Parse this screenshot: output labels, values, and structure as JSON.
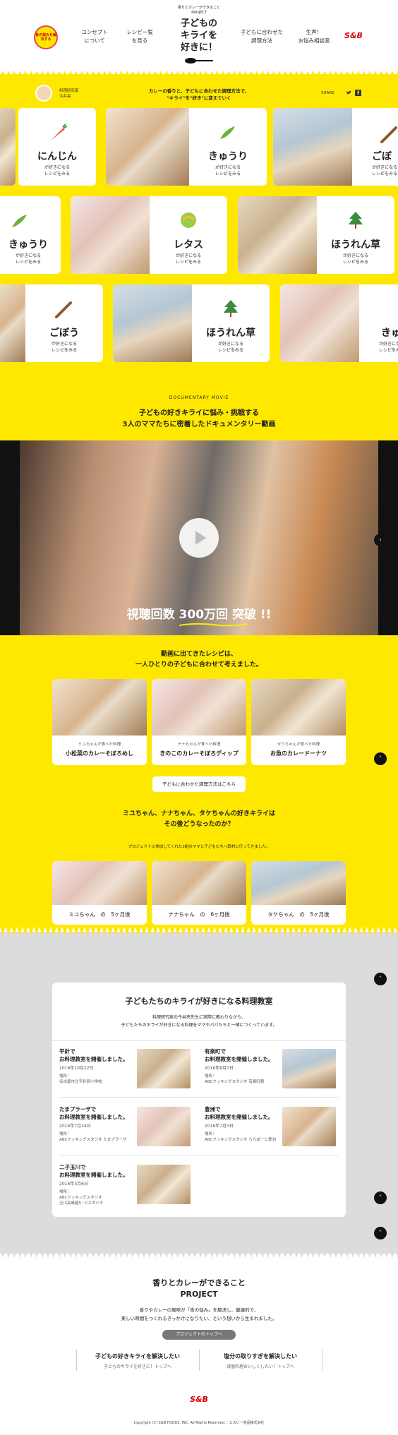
{
  "header": {
    "brand_sub": "香りとカレーができること PROJECT",
    "brand_title_1": "子どもの",
    "brand_title_2": "キライを",
    "brand_title_3": "好きに！",
    "nav": [
      {
        "label_1": "コンセプト",
        "label_2": "について"
      },
      {
        "label_1": "レシピ一覧",
        "label_2": "を見る"
      },
      {
        "label_1": "子どもに合わせた",
        "label_2": "調理方法"
      },
      {
        "label_1": "生声！",
        "label_2": "お悩み相談室"
      }
    ],
    "logo_badge": "食の悩みを解決する",
    "sb_logo": "S&B"
  },
  "tagline": {
    "person_1": "料理研究家",
    "person_2": "今井亮",
    "text_1": "カレーの香りと、子どもに合わせた調理方法で、",
    "text_2": "\"キライ\"を\"好き\"に変えていく",
    "share": "SHARE",
    "twitter_icon": "twitter-icon",
    "facebook_icon": "facebook-icon"
  },
  "vegetable_cards": {
    "sub_1": "が好きになる",
    "sub_2": "レシピをみる",
    "row1": [
      "にんじん",
      "きゅうり",
      "ごぼ"
    ],
    "row2": [
      "きゅうり",
      "レタス",
      "ほうれん草"
    ],
    "row3": [
      "ごぼう",
      "ほうれん草",
      "きゅ"
    ]
  },
  "documentary": {
    "eyebrow": "DOCUMENTARY MOVIE",
    "title_1": "子どもの好きキライに悩み・挑戦する",
    "title_2": "3人のママたちに密着したドキュメンタリー動画",
    "views": "視聴回数 300万回 突破 !!",
    "play_icon": "play-icon"
  },
  "recipes_section": {
    "title_1": "動画に出てきたレシピは、",
    "title_2": "一人ひとりの子どもに合わせて考えました。",
    "cards": [
      {
        "sub": "ミユちゃんが食べた料理",
        "name": "小松菜のカレーそぼろめし"
      },
      {
        "sub": "ナナちゃんが食べた料理",
        "name": "きのこのカレーそぼろディップ"
      },
      {
        "sub": "タケちゃんが食べた料理",
        "name": "お魚のカレードーナツ"
      }
    ],
    "method_button": "子どもに合わせた調理方法はこちら"
  },
  "after_section": {
    "title_1": "ミユちゃん、ナナちゃん、タケちゃんの好きキライは",
    "title_2": "その後どうなったのか？",
    "note": "プロジェクトに参加してくれた3組のママと子どもたちへ取材に行ってきました。",
    "cards": [
      "ミユちゃん　の　5ヶ月後",
      "ナナちゃん　の　6ヶ月後",
      "タケちゃん　の　5ヶ月後"
    ]
  },
  "cooking_class": {
    "title": "子どもたちのキライが好きになる料理教室",
    "desc_1": "料理研究家の今井亮先生に実際に教わりながら、",
    "desc_2": "子どもたちのキライが好きになる料理をママやパパたちと一緒につくっています。",
    "items": [
      {
        "title_1": "平針で",
        "title_2": "お料理教室を開催しました。",
        "date": "2016年10月22日",
        "venue_label": "場所：",
        "venue": "名古屋市立平針西小学校"
      },
      {
        "title_1": "有楽町で",
        "title_2": "お料理教室を開催しました。",
        "date": "2016年8月7日",
        "venue_label": "場所：",
        "venue": "ABCクッキングスタジオ 有楽町館"
      },
      {
        "title_1": "たまプラーザで",
        "title_2": "お料理教室を開催しました。",
        "date": "2016年7月24日",
        "venue_label": "場所：",
        "venue": "ABCクッキングスタジオ たまプラーザ"
      },
      {
        "title_1": "豊洲で",
        "title_2": "お料理教室を開催しました。",
        "date": "2016年7月3日",
        "venue_label": "場所：",
        "venue": "ABCクッキングスタジオ ららぽーと豊洲"
      },
      {
        "title_1": "二子玉川で",
        "title_2": "お料理教室を開催しました。",
        "date": "2016年3月6日",
        "venue_label": "場所：",
        "venue_1": "ABCクッキングスタジオ",
        "venue_2": "玉川高島屋S・Cスタジオ"
      }
    ]
  },
  "project": {
    "title_1": "香りとカレーができること",
    "title_2": "PROJECT",
    "desc_1": "香りやカレーの風味が「食の悩み」を解決し、健康的で、",
    "desc_2": "楽しい時間をつくれるきっかけになりたい、という想いから生まれました。",
    "top_button": "プロジェクトのトップへ",
    "links": [
      {
        "title": "子どもの好きキライを解決したい",
        "sub": "子どものキライを好きに！トップへ"
      },
      {
        "title": "塩分の取りすぎを解決したい",
        "sub": "減塩料理おいしくしたい！トップへ"
      }
    ]
  },
  "footer": {
    "logo": "S&B",
    "copyright": "Copyright (C) S&B FOODS, INC. All Rights Reserved.｜エスビー食品株式会社"
  },
  "colors": {
    "accent": "#ffe800",
    "gray": "#dcdcdc",
    "text": "#222222"
  }
}
